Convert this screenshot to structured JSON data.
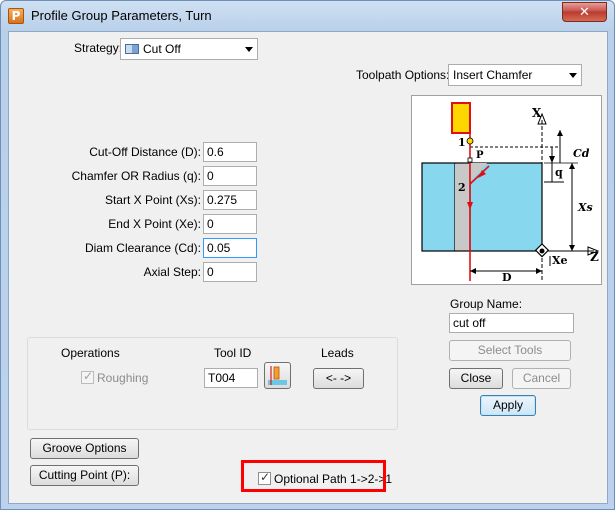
{
  "window": {
    "title": "Profile Group Parameters, Turn",
    "close_glyph": "✕"
  },
  "strategy": {
    "label": "Strategy:",
    "value": "Cut Off"
  },
  "toolpath_options": {
    "label": "Toolpath Options:",
    "value": "Insert Chamfer"
  },
  "fields": [
    {
      "label": "Cut-Off Distance (D):",
      "value": "0.6"
    },
    {
      "label": "Chamfer OR Radius (q):",
      "value": "0"
    },
    {
      "label": "Start X Point (Xs):",
      "value": "0.275"
    },
    {
      "label": "End X Point (Xe):",
      "value": "0"
    },
    {
      "label": "Diam Clearance (Cd):",
      "value": "0.05"
    },
    {
      "label": "Axial Step:",
      "value": "0"
    }
  ],
  "diagram": {
    "x_axis": "X",
    "z_axis": "Z",
    "point1": "1",
    "point2": "2",
    "p": "P",
    "cd": "Cd",
    "q": "q",
    "xs": "Xs",
    "xe": "Xe",
    "d": "D"
  },
  "group": {
    "label": "Group Name:",
    "value": "cut off"
  },
  "buttons": {
    "select_tools": "Select Tools",
    "close": "Close",
    "cancel": "Cancel",
    "apply": "Apply",
    "groove_options": "Groove Options",
    "cutting_point": "Cutting Point (P):",
    "leads": "<- ->"
  },
  "operations": {
    "col_operations": "Operations",
    "col_tool_id": "Tool ID",
    "col_leads": "Leads",
    "roughing_label": "Roughing",
    "roughing_checked": true,
    "tool_id": "T004"
  },
  "optional_path": {
    "label": "Optional Path 1->2->1",
    "checked": true
  },
  "colors": {
    "part_fill": "#87d7ef",
    "path": "#e01010",
    "tool": "#ffd700",
    "highlight": "#ff0000"
  }
}
